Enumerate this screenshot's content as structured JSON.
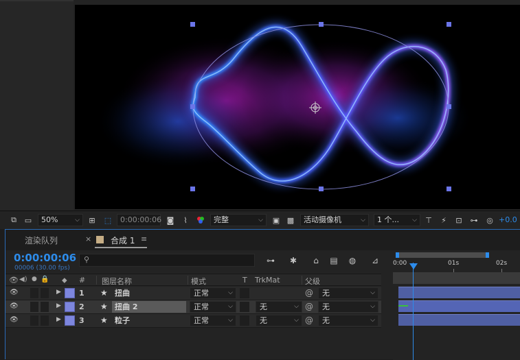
{
  "viewer": {
    "zoom": "50%",
    "timecode": "0:00:00:06",
    "resolution": "完整",
    "camera": "活动摄像机",
    "views": "1 个...",
    "exposure": "+0.0"
  },
  "timeline": {
    "tabs": {
      "render_queue": "渲染队列",
      "close": "×",
      "comp": "合成 1",
      "menu": "≡"
    },
    "current_time": "0:00:00:06",
    "frame_info": "00006 (30.00 fps)",
    "search": {
      "value": "",
      "placeholder": ""
    },
    "columns": {
      "hash": "#",
      "layer_name": "图层名称",
      "mode": "模式",
      "t": "T",
      "trkmat": "TrkMat",
      "parent": "父级"
    },
    "ruler": {
      "t0": "0:00",
      "t1": "01s",
      "t2": "02s"
    },
    "layers": [
      {
        "num": "1",
        "name": "扭曲",
        "mode": "正常",
        "trkmat": "",
        "parent": "无"
      },
      {
        "num": "2",
        "name": "扭曲 2",
        "mode": "正常",
        "trkmat": "无",
        "parent": "无"
      },
      {
        "num": "3",
        "name": "粒子",
        "mode": "正常",
        "trkmat": "无",
        "parent": "无"
      }
    ]
  },
  "colors": {
    "accent": "#2d8ceb",
    "layer_label": "#7d86de",
    "comp_label": "#c6ad85"
  },
  "icons": {
    "region": "region-of-interest-icon",
    "snapshot": "camera-icon",
    "channels": "color-channels-icon",
    "pickwhip": "pickwhip-icon",
    "solo": "solo-icon"
  }
}
